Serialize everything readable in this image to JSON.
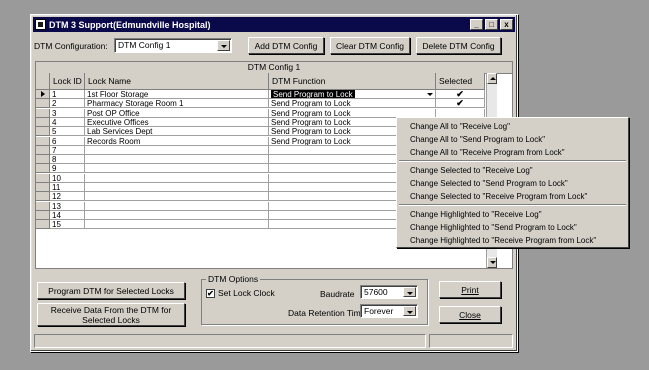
{
  "window": {
    "title": "DTM 3 Support(Edmundville Hospital)",
    "buttons": {
      "minimize": "_",
      "maximize": "□",
      "close": "x"
    }
  },
  "toolbar": {
    "config_label": "DTM Configuration:",
    "config_value": "DTM Config 1",
    "add_label": "Add DTM Config",
    "clear_label": "Clear DTM Config",
    "delete_label": "Delete DTM Config"
  },
  "grid": {
    "caption": "DTM Config 1",
    "headers": {
      "lock_id": "Lock ID",
      "lock_name": "Lock Name",
      "function": "DTM Function",
      "selected": "Selected"
    },
    "rows": [
      {
        "id": "1",
        "name": "1st Floor Storage",
        "function": "Send Program to Lock",
        "selected": "✔"
      },
      {
        "id": "2",
        "name": "Pharmacy Storage Room 1",
        "function": "Send Program to Lock",
        "selected": "✔"
      },
      {
        "id": "3",
        "name": "Post OP Office",
        "function": "Send Program to Lock",
        "selected": ""
      },
      {
        "id": "4",
        "name": "Executive Offices",
        "function": "Send Program to Lock",
        "selected": ""
      },
      {
        "id": "5",
        "name": "Lab Services Dept",
        "function": "Send Program to Lock",
        "selected": ""
      },
      {
        "id": "6",
        "name": "Records Room",
        "function": "Send Program to Lock",
        "selected": ""
      },
      {
        "id": "7",
        "name": "",
        "function": "",
        "selected": ""
      },
      {
        "id": "8",
        "name": "",
        "function": "",
        "selected": ""
      },
      {
        "id": "9",
        "name": "",
        "function": "",
        "selected": ""
      },
      {
        "id": "10",
        "name": "",
        "function": "",
        "selected": ""
      },
      {
        "id": "11",
        "name": "",
        "function": "",
        "selected": ""
      },
      {
        "id": "12",
        "name": "",
        "function": "",
        "selected": ""
      },
      {
        "id": "13",
        "name": "",
        "function": "",
        "selected": ""
      },
      {
        "id": "14",
        "name": "",
        "function": "",
        "selected": ""
      },
      {
        "id": "15",
        "name": "",
        "function": "",
        "selected": ""
      }
    ]
  },
  "bottom": {
    "program_button": "Program DTM for Selected Locks",
    "receive_button_line1": "Receive Data From the DTM for",
    "receive_button_line2": "Selected Locks",
    "options_title": "DTM Options",
    "set_clock_label": "Set Lock Clock",
    "set_clock_checked": "✔",
    "baudrate_label": "Baudrate",
    "baudrate_value": "57600",
    "retention_label": "Data Retention Time",
    "retention_value": "Forever",
    "print_label": "Print",
    "close_label": "Close"
  },
  "context_menu": {
    "items": [
      "Change All to \"Receive Log\"",
      "Change All to \"Send Program to Lock\"",
      "Change All to \"Receive Program from Lock\"",
      "Change Selected to \"Receive Log\"",
      "Change Selected to \"Send Program to Lock\"",
      "Change Selected to \"Receive Program from Lock\"",
      "Change Highlighted to \"Receive Log\"",
      "Change Highlighted to \"Send Program to Lock\"",
      "Change Highlighted to \"Receive Program from Lock\""
    ]
  }
}
